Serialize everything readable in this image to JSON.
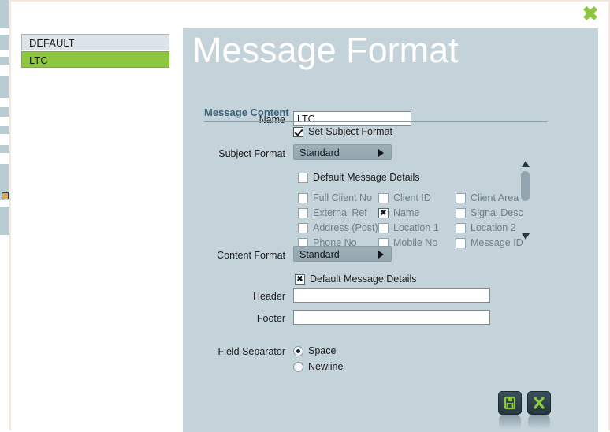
{
  "window": {
    "close_icon": "close-x-icon",
    "accent_green": "#8dc63f",
    "panel_bg": "#c4d2d9",
    "heading_color": "#3d6379"
  },
  "sidebar": {
    "items": [
      {
        "label": "DEFAULT",
        "selected": false
      },
      {
        "label": "LTC",
        "selected": true
      }
    ]
  },
  "main": {
    "title": "Message Format",
    "name_label": "Name",
    "name_value": "LTC",
    "name_placeholder": "",
    "section_heading": "Message Content",
    "set_subject_format": {
      "label": "Set Subject Format",
      "checked": true
    },
    "subject_format": {
      "label": "Subject Format",
      "value": "Standard",
      "options": [
        "Standard"
      ]
    },
    "subject_default_details": {
      "label": "Default Message Details",
      "checked": false
    },
    "detail_fields": [
      {
        "label": "Full Client No",
        "checked": false
      },
      {
        "label": "Client ID",
        "checked": false
      },
      {
        "label": "Client Area",
        "checked": false
      },
      {
        "label": "External Ref",
        "checked": false
      },
      {
        "label": "Name",
        "checked": true
      },
      {
        "label": "Signal Desc",
        "checked": false
      },
      {
        "label": "Address (Post)",
        "checked": false
      },
      {
        "label": "Location 1",
        "checked": false
      },
      {
        "label": "Location 2",
        "checked": false
      },
      {
        "label": "Phone No",
        "checked": false
      },
      {
        "label": "Mobile No",
        "checked": false
      },
      {
        "label": "Message ID",
        "checked": false
      }
    ],
    "scrollbar": {
      "up_icon": "triangle-up-icon",
      "down_icon": "triangle-down-icon"
    },
    "content_format": {
      "label": "Content Format",
      "value": "Standard",
      "options": [
        "Standard"
      ]
    },
    "content_default_details": {
      "label": "Default Message Details",
      "checked": true,
      "mark": "x"
    },
    "header_field": {
      "label": "Header",
      "value": "",
      "placeholder": ""
    },
    "footer_field": {
      "label": "Footer",
      "value": "",
      "placeholder": ""
    },
    "field_separator": {
      "label": "Field Separator",
      "options": [
        {
          "label": "Space",
          "selected": true
        },
        {
          "label": "Newline",
          "selected": false
        }
      ]
    }
  },
  "actions": {
    "save": {
      "icon": "save-floppy-icon",
      "label": "Save"
    },
    "cancel": {
      "icon": "cancel-x-icon",
      "label": "Cancel"
    }
  }
}
